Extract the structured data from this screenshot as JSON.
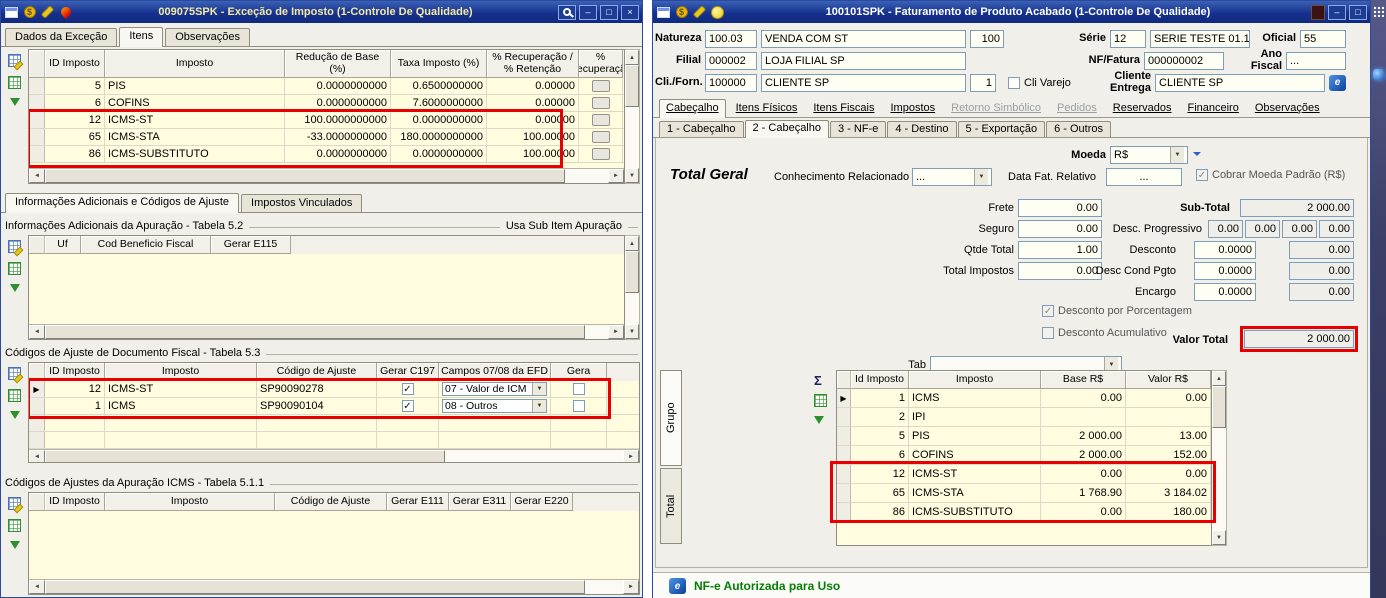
{
  "icons": {
    "money": "$",
    "minimize": "–",
    "maximize": "□",
    "close": "×",
    "sigma": "Σ",
    "nfe_glyph": "e",
    "row_marker": "▶",
    "check": "✓",
    "dropdown": "▼"
  },
  "colors": {
    "annotation_red": "#e80000",
    "status_green": "#067d06",
    "titlebar_blue": "#16318e",
    "grid_cream": "#fffcdf"
  },
  "left_window": {
    "title": "009075SPK - Exceção de Imposto (1-Controle De Qualidade)",
    "tabs": [
      "Dados da Exceção",
      "Itens",
      "Observações"
    ],
    "impostos_grid": {
      "columns": [
        "ID Imposto",
        "Imposto",
        "Redução de Base (%)",
        "Taxa Imposto (%)",
        "% Recuperação / % Retenção",
        "% Recuperação"
      ],
      "rows": [
        {
          "marker": "",
          "id": "5",
          "imposto": "PIS",
          "reducao": "0.0000000000",
          "taxa": "0.6500000000",
          "recuperacao": "0.00000"
        },
        {
          "marker": "",
          "id": "6",
          "imposto": "COFINS",
          "reducao": "0.0000000000",
          "taxa": "7.6000000000",
          "recuperacao": "0.00000"
        },
        {
          "marker": "",
          "id": "12",
          "imposto": "ICMS-ST",
          "reducao": "100.0000000000",
          "taxa": "0.0000000000",
          "recuperacao": "0.00000"
        },
        {
          "marker": "",
          "id": "65",
          "imposto": "ICMS-STA",
          "reducao": "-33.0000000000",
          "taxa": "180.0000000000",
          "recuperacao": "100.00000"
        },
        {
          "marker": "",
          "id": "86",
          "imposto": "ICMS-SUBSTITUTO",
          "reducao": "0.0000000000",
          "taxa": "0.0000000000",
          "recuperacao": "100.00000"
        }
      ]
    },
    "lower_tabs": [
      "Informações Adicionais e Códigos de Ajuste",
      "Impostos Vinculados"
    ],
    "apuracao_section": {
      "title": "Informações Adicionais da Apuração - Tabela 5.2",
      "right_label": "Usa Sub Item Apuração",
      "columns": [
        "Uf",
        "Cod Beneficio Fiscal",
        "Gerar E115"
      ]
    },
    "ajuste_doc_section": {
      "title": "Códigos de Ajuste de Documento Fiscal - Tabela 5.3",
      "columns": [
        "ID Imposto",
        "Imposto",
        "Código de Ajuste",
        "Gerar C197",
        "Campos 07/08 da EFD",
        "Gera"
      ],
      "rows": [
        {
          "marker": "▶",
          "id": "12",
          "imposto": "ICMS-ST",
          "codigo": "SP90090278",
          "c197": true,
          "campos": "07 - Valor de ICM",
          "gera": false
        },
        {
          "marker": "",
          "id": "1",
          "imposto": "ICMS",
          "codigo": "SP90090104",
          "c197": true,
          "campos": "08 - Outros",
          "gera": false
        }
      ]
    },
    "ajuste_apuracao_section": {
      "title": "Códigos de Ajustes da Apuração ICMS - Tabela 5.1.1",
      "columns": [
        "ID Imposto",
        "Imposto",
        "Código de Ajuste",
        "Gerar E111",
        "Gerar E311",
        "Gerar E220"
      ]
    }
  },
  "right_window": {
    "title": "100101SPK - Faturamento de Produto Acabado (1-Controle De Qualidade)",
    "header": {
      "natureza_label": "Natureza",
      "natureza_code": "100.03",
      "natureza_desc": "VENDA COM ST",
      "natureza_extra": "100",
      "serie_label": "Série",
      "serie_code": "12",
      "serie_desc": "SERIE TESTE 01.1",
      "oficial_label": "Oficial",
      "oficial_value": "55",
      "filial_label": "Filial",
      "filial_code": "000002",
      "filial_desc": "LOJA FILIAL SP",
      "nf_label": "NF/Fatura",
      "nf_value": "000000002",
      "ano_label": "Ano Fiscal",
      "ano_value": "...",
      "cli_label": "Cli./Forn.",
      "cli_code": "100000",
      "cli_desc": "CLIENTE SP",
      "cli_extra": "1",
      "cli_varejo_label": "Cli Varejo",
      "cli_varejo_checked": false,
      "cliente_entrega_label": "Cliente Entrega",
      "cliente_entrega_value": "CLIENTE SP"
    },
    "tabs": [
      "Cabeçalho",
      "Itens Físicos",
      "Itens Fiscais",
      "Impostos",
      "Retorno Simbólico",
      "Pedidos",
      "Reservados",
      "Financeiro",
      "Observações"
    ],
    "sub_tabs": [
      "1 - Cabeçalho",
      "2 - Cabeçalho",
      "3 - NF-e",
      "4 - Destino",
      "5 - Exportação",
      "6 - Outros"
    ],
    "totals": {
      "section_title": "Total Geral",
      "moeda_label": "Moeda",
      "moeda_value": "R$",
      "conhecimento_label": "Conhecimento Relacionado",
      "conhecimento_value": "...",
      "data_fat_label": "Data Fat. Relativo",
      "data_fat_value": "...",
      "cobrar_moeda_label": "Cobrar Moeda Padrão (R$)",
      "cobrar_moeda_checked": true,
      "frete_label": "Frete",
      "frete_value": "0.00",
      "seguro_label": "Seguro",
      "seguro_value": "0.00",
      "qtde_label": "Qtde Total",
      "qtde_value": "1.00",
      "impostos_label": "Total Impostos",
      "impostos_value": "0.00",
      "subtotal_label": "Sub-Total",
      "subtotal_value": "2 000.00",
      "desc_prog_label": "Desc. Progressivo",
      "desc_prog_values": [
        "0.00",
        "0.00",
        "0.00",
        "0.00"
      ],
      "desconto_label": "Desconto",
      "desconto_pct": "0.0000",
      "desconto_value": "0.00",
      "desc_cond_label": "Desc Cond Pgto",
      "desc_cond_pct": "0.0000",
      "desc_cond_value": "0.00",
      "encargo_label": "Encargo",
      "encargo_pct": "0.0000",
      "encargo_value": "0.00",
      "desc_porcentagem_label": "Desconto por Porcentagem",
      "desc_porcentagem_checked": true,
      "desc_acumulativo_label": "Desconto Acumulativo",
      "desc_acumulativo_checked": false,
      "valor_total_label": "Valor Total",
      "valor_total_value": "2 000.00",
      "tab_label": "Tab",
      "tab_value": ""
    },
    "impostos_grid": {
      "side_tabs": [
        "Grupo",
        "Total"
      ],
      "columns": [
        "Id Imposto",
        "Imposto",
        "Base R$",
        "Valor R$"
      ],
      "rows": [
        {
          "marker": "▶",
          "id": "1",
          "imposto": "ICMS",
          "base": "0.00",
          "valor": "0.00"
        },
        {
          "marker": "",
          "id": "2",
          "imposto": "IPI",
          "base": "",
          "valor": ""
        },
        {
          "marker": "",
          "id": "5",
          "imposto": "PIS",
          "base": "2 000.00",
          "valor": "13.00"
        },
        {
          "marker": "",
          "id": "6",
          "imposto": "COFINS",
          "base": "2 000.00",
          "valor": "152.00"
        },
        {
          "marker": "",
          "id": "12",
          "imposto": "ICMS-ST",
          "base": "0.00",
          "valor": "0.00"
        },
        {
          "marker": "",
          "id": "65",
          "imposto": "ICMS-STA",
          "base": "1 768.90",
          "valor": "3 184.02"
        },
        {
          "marker": "",
          "id": "86",
          "imposto": "ICMS-SUBSTITUTO",
          "base": "0.00",
          "valor": "180.00"
        }
      ]
    },
    "status": {
      "message": "NF-e Autorizada para Uso"
    }
  }
}
